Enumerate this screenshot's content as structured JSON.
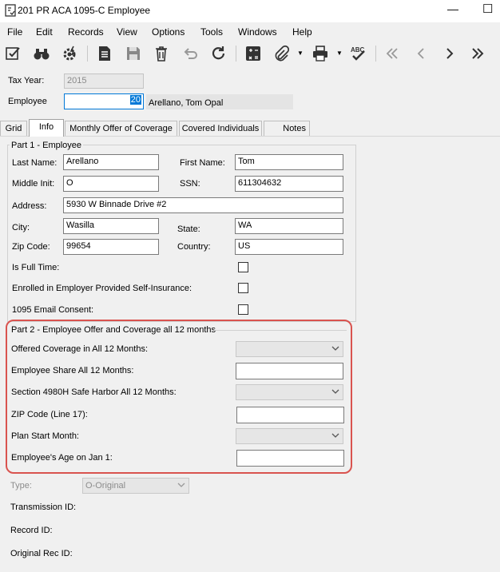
{
  "window": {
    "title": "201 PR ACA 1095-C Employee",
    "minimize_glyph": "—",
    "maximize_glyph": "☐"
  },
  "menu": [
    "File",
    "Edit",
    "Records",
    "View",
    "Options",
    "Tools",
    "Windows",
    "Help"
  ],
  "toolbar": {
    "icons": [
      "edit-check-icon",
      "binoculars-icon",
      "gear-bolt-icon",
      "document-icon",
      "save-disk-icon",
      "trash-icon",
      "undo-icon",
      "refresh-icon",
      "calculator-icon",
      "paperclip-icon",
      "printer-icon",
      "spellcheck-icon",
      "first-record-icon",
      "previous-record-icon",
      "next-record-icon",
      "last-record-icon"
    ],
    "spellcheck_text": "ABC"
  },
  "header": {
    "tax_year_label": "Tax Year:",
    "tax_year_value": "2015",
    "employee_label": "Employee",
    "employee_value": "20",
    "employee_name": "Arellano, Tom Opal"
  },
  "tabs": [
    "Grid",
    "Info",
    "Monthly Offer of Coverage",
    "Covered Individuals",
    "Notes"
  ],
  "active_tab": "Info",
  "part1": {
    "title": "Part 1 - Employee",
    "last_name_label": "Last Name:",
    "last_name": "Arellano",
    "first_name_label": "First Name:",
    "first_name": "Tom",
    "middle_init_label": "Middle Init:",
    "middle_init": "O",
    "ssn_label": "SSN:",
    "ssn": "611304632",
    "address_label": "Address:",
    "address": "5930 W Binnade Drive #2",
    "city_label": "City:",
    "city": "Wasilla",
    "state_label": "State:",
    "state": "WA",
    "zip_label": "Zip Code:",
    "zip": "99654",
    "country_label": "Country:",
    "country": "US",
    "full_time_label": "Is Full Time:",
    "self_insurance_label": "Enrolled in Employer Provided Self-Insurance:",
    "email_consent_label": "1095 Email Consent:"
  },
  "part2": {
    "title": "Part 2 - Employee Offer and Coverage all 12 months",
    "offered_coverage_label": "Offered Coverage in All 12 Months:",
    "employee_share_label": "Employee Share All 12 Months:",
    "safe_harbor_label": "Section 4980H Safe Harbor All 12 Months:",
    "zip_line17_label": "ZIP Code (Line 17):",
    "plan_start_label": "Plan Start Month:",
    "age_label": "Employee's Age on Jan 1:"
  },
  "footer": {
    "type_label": "Type:",
    "type_value": "O-Original",
    "transmission_label": "Transmission ID:",
    "record_id_label": "Record ID:",
    "original_rec_label": "Original Rec ID:"
  },
  "colors": {
    "highlight_border": "#d9534f",
    "selection": "#0078d7"
  }
}
